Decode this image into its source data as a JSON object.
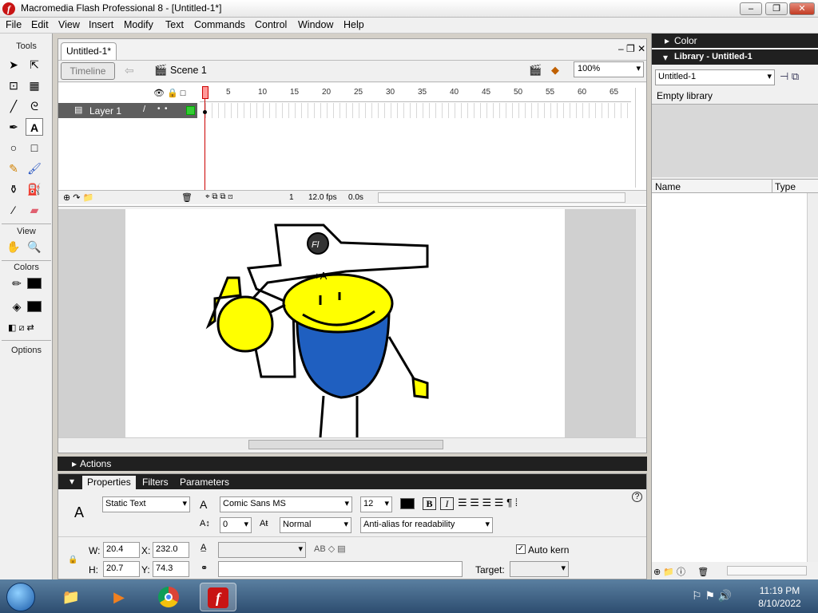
{
  "window": {
    "title": "Macromedia Flash Professional 8 - [Untitled-1*]",
    "app_icon": "flash-icon",
    "minimize": "–",
    "maximize": "❐",
    "close": "✕"
  },
  "menu": [
    "File",
    "Edit",
    "View",
    "Insert",
    "Modify",
    "Text",
    "Commands",
    "Control",
    "Window",
    "Help"
  ],
  "tools": {
    "header": "Tools",
    "view_label": "View",
    "colors_label": "Colors",
    "options_label": "Options"
  },
  "document": {
    "tab": "Untitled-1*",
    "timeline_button": "Timeline",
    "scene": "Scene 1",
    "zoom": "100%"
  },
  "timeline": {
    "layer": "Layer 1",
    "ruler": [
      "5",
      "10",
      "15",
      "20",
      "25",
      "30",
      "35",
      "40",
      "45",
      "50",
      "55",
      "60",
      "65"
    ],
    "frame": "1",
    "fps": "12.0 fps",
    "time": "0.0s"
  },
  "panels": {
    "actions": "Actions",
    "tabs": [
      "Properties",
      "Filters",
      "Parameters"
    ]
  },
  "properties": {
    "text_type": "Static Text",
    "font": "Comic Sans MS",
    "size": "12",
    "tracking": "0",
    "position": "Normal",
    "antialias": "Anti-alias for readability",
    "w": "20.4",
    "h": "20.7",
    "x": "232.0",
    "y": "74.3",
    "w_label": "W:",
    "h_label": "H:",
    "x_label": "X:",
    "y_label": "Y:",
    "auto_kern": "Auto kern",
    "target_label": "Target:",
    "bold": "B",
    "italic": "I"
  },
  "right_panel": {
    "color": "Color",
    "library_title": "Library - Untitled-1",
    "library_select": "Untitled-1",
    "empty": "Empty library",
    "col_name": "Name",
    "col_type": "Type"
  },
  "taskbar": {
    "time": "11:19 PM",
    "date": "8/10/2022"
  },
  "colors": {
    "flash_red": "#c81414",
    "fill_yellow": "#ffff00",
    "body_blue": "#1f5fc0",
    "stroke": "#000000"
  }
}
